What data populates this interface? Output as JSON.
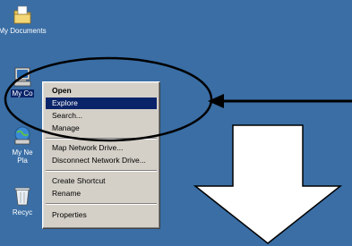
{
  "desktop": {
    "icons": [
      {
        "label": "My Documents"
      },
      {
        "label": "My Co"
      },
      {
        "label": "My Ne",
        "label2": "Pla"
      },
      {
        "label": "Recyc"
      }
    ]
  },
  "context_menu": {
    "items": [
      {
        "label": "Open",
        "style": "bold"
      },
      {
        "label": "Explore",
        "style": "highlighted"
      },
      {
        "label": "Search..."
      },
      {
        "label": "Manage"
      },
      {
        "label": "Map Network Drive..."
      },
      {
        "label": "Disconnect Network Drive..."
      },
      {
        "label": "Create Shortcut"
      },
      {
        "label": "Rename"
      },
      {
        "label": "Properties"
      }
    ]
  },
  "colors": {
    "desktop_bg": "#3a6ea5",
    "menu_bg": "#d4d0c8",
    "highlight": "#0a246a"
  },
  "icon_names": [
    "folder-documents-icon",
    "computer-icon",
    "network-places-icon",
    "recycle-bin-icon"
  ]
}
